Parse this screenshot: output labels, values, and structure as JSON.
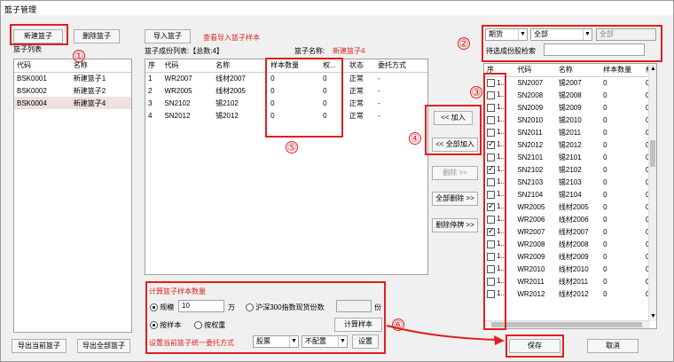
{
  "window": {
    "title": "篮子管理",
    "close": "×"
  },
  "left": {
    "new_btn": "新建篮子",
    "delete_btn": "删除篮子",
    "list_label": "篮子列表",
    "headers": [
      "代码",
      "名称"
    ],
    "rows": [
      [
        "BSK0001",
        "新建篮子1"
      ],
      [
        "BSK0002",
        "新建篮子2"
      ],
      [
        "BSK0004",
        "新建篮子4"
      ]
    ],
    "export_current": "导出当前篮子",
    "export_all": "导出全部篮子"
  },
  "middle": {
    "import_btn": "导入篮子",
    "view_sample": "查看导入篮子样本",
    "list_label": "篮子成份列表:【总数:4】",
    "name_label": "篮子名称:",
    "name_value": "新建篮子4",
    "headers": [
      "序",
      "代码",
      "名称",
      "样本数量",
      "权...",
      "状态",
      "委托方式"
    ],
    "rows": [
      [
        "1",
        "WR2007",
        "线材2007",
        "0",
        "0",
        "正常",
        "-"
      ],
      [
        "2",
        "WR2005",
        "线材2005",
        "0",
        "0",
        "正常",
        "-"
      ],
      [
        "3",
        "SN2102",
        "锡2102",
        "0",
        "0",
        "正常",
        "-"
      ],
      [
        "4",
        "SN2012",
        "锡2012",
        "0",
        "0",
        "正常",
        "-"
      ]
    ]
  },
  "actions": {
    "add": "<< 加入",
    "add_all": "<< 全部加入",
    "remove": "删除 >>",
    "remove_all": "全部删除 >>",
    "remove_stopped": "删除停牌 >>"
  },
  "calc": {
    "title": "计算篮子样本数量",
    "scale_label": "规模",
    "scale_value": "10",
    "unit": "万",
    "hs300_label": "沪深300指数现货份数",
    "share_unit": "份",
    "by_sample": "按样本",
    "by_weight": "按权重",
    "calc_btn": "计算样本",
    "set_label": "设置当前篮子统一委托方式",
    "opt1": "股票",
    "opt2": "不配置",
    "set_btn": "设置"
  },
  "right": {
    "filter1": "期货",
    "filter2": "全部",
    "filter3": "全部",
    "search_label": "待选成份股检索",
    "headers": [
      "序",
      "代码",
      "名称",
      "样本数量",
      "权"
    ],
    "rows": [
      {
        "n": "1...",
        "code": "SN2007",
        "name": "锡2007",
        "qty": "0",
        "w": "0",
        "checked": false
      },
      {
        "n": "1...",
        "code": "SN2008",
        "name": "锡2008",
        "qty": "0",
        "w": "0",
        "checked": false
      },
      {
        "n": "1...",
        "code": "SN2009",
        "name": "锡2009",
        "qty": "0",
        "w": "0",
        "checked": false
      },
      {
        "n": "1...",
        "code": "SN2010",
        "name": "锡2010",
        "qty": "0",
        "w": "0",
        "checked": false
      },
      {
        "n": "1...",
        "code": "SN2011",
        "name": "锡2011",
        "qty": "0",
        "w": "0",
        "checked": false
      },
      {
        "n": "1...",
        "code": "SN2012",
        "name": "锡2012",
        "qty": "0",
        "w": "0",
        "checked": true
      },
      {
        "n": "1...",
        "code": "SN2101",
        "name": "锡2101",
        "qty": "0",
        "w": "0",
        "checked": false
      },
      {
        "n": "1...",
        "code": "SN2102",
        "name": "锡2102",
        "qty": "0",
        "w": "0",
        "checked": true
      },
      {
        "n": "1...",
        "code": "SN2103",
        "name": "锡2103",
        "qty": "0",
        "w": "0",
        "checked": false
      },
      {
        "n": "1...",
        "code": "SN2104",
        "name": "锡2104",
        "qty": "0",
        "w": "0",
        "checked": false
      },
      {
        "n": "1...",
        "code": "WR2005",
        "name": "线材2005",
        "qty": "0",
        "w": "0",
        "checked": true
      },
      {
        "n": "1...",
        "code": "WR2006",
        "name": "线材2006",
        "qty": "0",
        "w": "0",
        "checked": false
      },
      {
        "n": "1...",
        "code": "WR2007",
        "name": "线材2007",
        "qty": "0",
        "w": "0",
        "checked": true
      },
      {
        "n": "1...",
        "code": "WR2008",
        "name": "线材2008",
        "qty": "0",
        "w": "0",
        "checked": false
      },
      {
        "n": "1...",
        "code": "WR2009",
        "name": "线材2009",
        "qty": "0",
        "w": "0",
        "checked": false
      },
      {
        "n": "1...",
        "code": "WR2010",
        "name": "线材2010",
        "qty": "0",
        "w": "0",
        "checked": false
      },
      {
        "n": "1...",
        "code": "WR2011",
        "name": "线材2011",
        "qty": "0",
        "w": "0",
        "checked": false
      },
      {
        "n": "1...",
        "code": "WR2012",
        "name": "线材2012",
        "qty": "0",
        "w": "0",
        "checked": false
      }
    ]
  },
  "footer": {
    "save": "保存",
    "cancel": "取消"
  },
  "markers": [
    "①",
    "②",
    "③",
    "④",
    "⑤",
    "⑥"
  ]
}
